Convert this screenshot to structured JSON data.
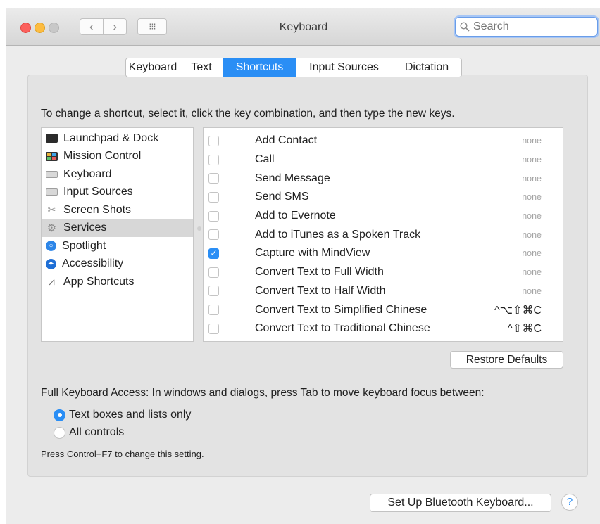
{
  "window": {
    "title": "Keyboard"
  },
  "toolbar": {
    "back_icon": "‹",
    "forward_icon": "›",
    "grid_icon": "⁝⁝⁝",
    "search_placeholder": "Search"
  },
  "tabs": [
    {
      "label": "Keyboard",
      "active": false
    },
    {
      "label": "Text",
      "active": false
    },
    {
      "label": "Shortcuts",
      "active": true
    },
    {
      "label": "Input Sources",
      "active": false
    },
    {
      "label": "Dictation",
      "active": false
    }
  ],
  "instruction": "To change a shortcut, select it, click the key combination, and then type the new keys.",
  "categories": [
    {
      "label": "Launchpad & Dock",
      "icon": "launchpad-icon"
    },
    {
      "label": "Mission Control",
      "icon": "mission-control-icon"
    },
    {
      "label": "Keyboard",
      "icon": "keyboard-icon"
    },
    {
      "label": "Input Sources",
      "icon": "input-sources-icon"
    },
    {
      "label": "Screen Shots",
      "icon": "screenshots-icon"
    },
    {
      "label": "Services",
      "icon": "services-gear-icon",
      "selected": true
    },
    {
      "label": "Spotlight",
      "icon": "spotlight-icon"
    },
    {
      "label": "Accessibility",
      "icon": "accessibility-icon"
    },
    {
      "label": "App Shortcuts",
      "icon": "app-shortcuts-icon"
    }
  ],
  "shortcuts": [
    {
      "label": "Add Contact",
      "key": "none",
      "checked": false
    },
    {
      "label": "Call",
      "key": "none",
      "checked": false
    },
    {
      "label": "Send Message",
      "key": "none",
      "checked": false
    },
    {
      "label": "Send SMS",
      "key": "none",
      "checked": false
    },
    {
      "label": "Add to Evernote",
      "key": "none",
      "checked": false
    },
    {
      "label": "Add to iTunes as a Spoken Track",
      "key": "none",
      "checked": false
    },
    {
      "label": "Capture with MindView",
      "key": "none",
      "checked": true
    },
    {
      "label": "Convert Text to Full Width",
      "key": "none",
      "checked": false
    },
    {
      "label": "Convert Text to Half Width",
      "key": "none",
      "checked": false
    },
    {
      "label": "Convert Text to Simplified Chinese",
      "key": "^⌥⇧⌘C",
      "checked": false
    },
    {
      "label": "Convert Text to Traditional Chinese",
      "key": "^⇧⌘C",
      "checked": false
    }
  ],
  "restore_defaults_label": "Restore Defaults",
  "full_keyboard_access": {
    "label": "Full Keyboard Access: In windows and dialogs, press Tab to move keyboard focus between:",
    "options": [
      {
        "label": "Text boxes and lists only",
        "selected": true
      },
      {
        "label": "All controls",
        "selected": false
      }
    ],
    "hint": "Press Control+F7 to change this setting."
  },
  "bluetooth_button_label": "Set Up Bluetooth Keyboard...",
  "help_button_label": "?",
  "colors": {
    "accent": "#2a8ef5",
    "panel": "#e3e3e3"
  }
}
